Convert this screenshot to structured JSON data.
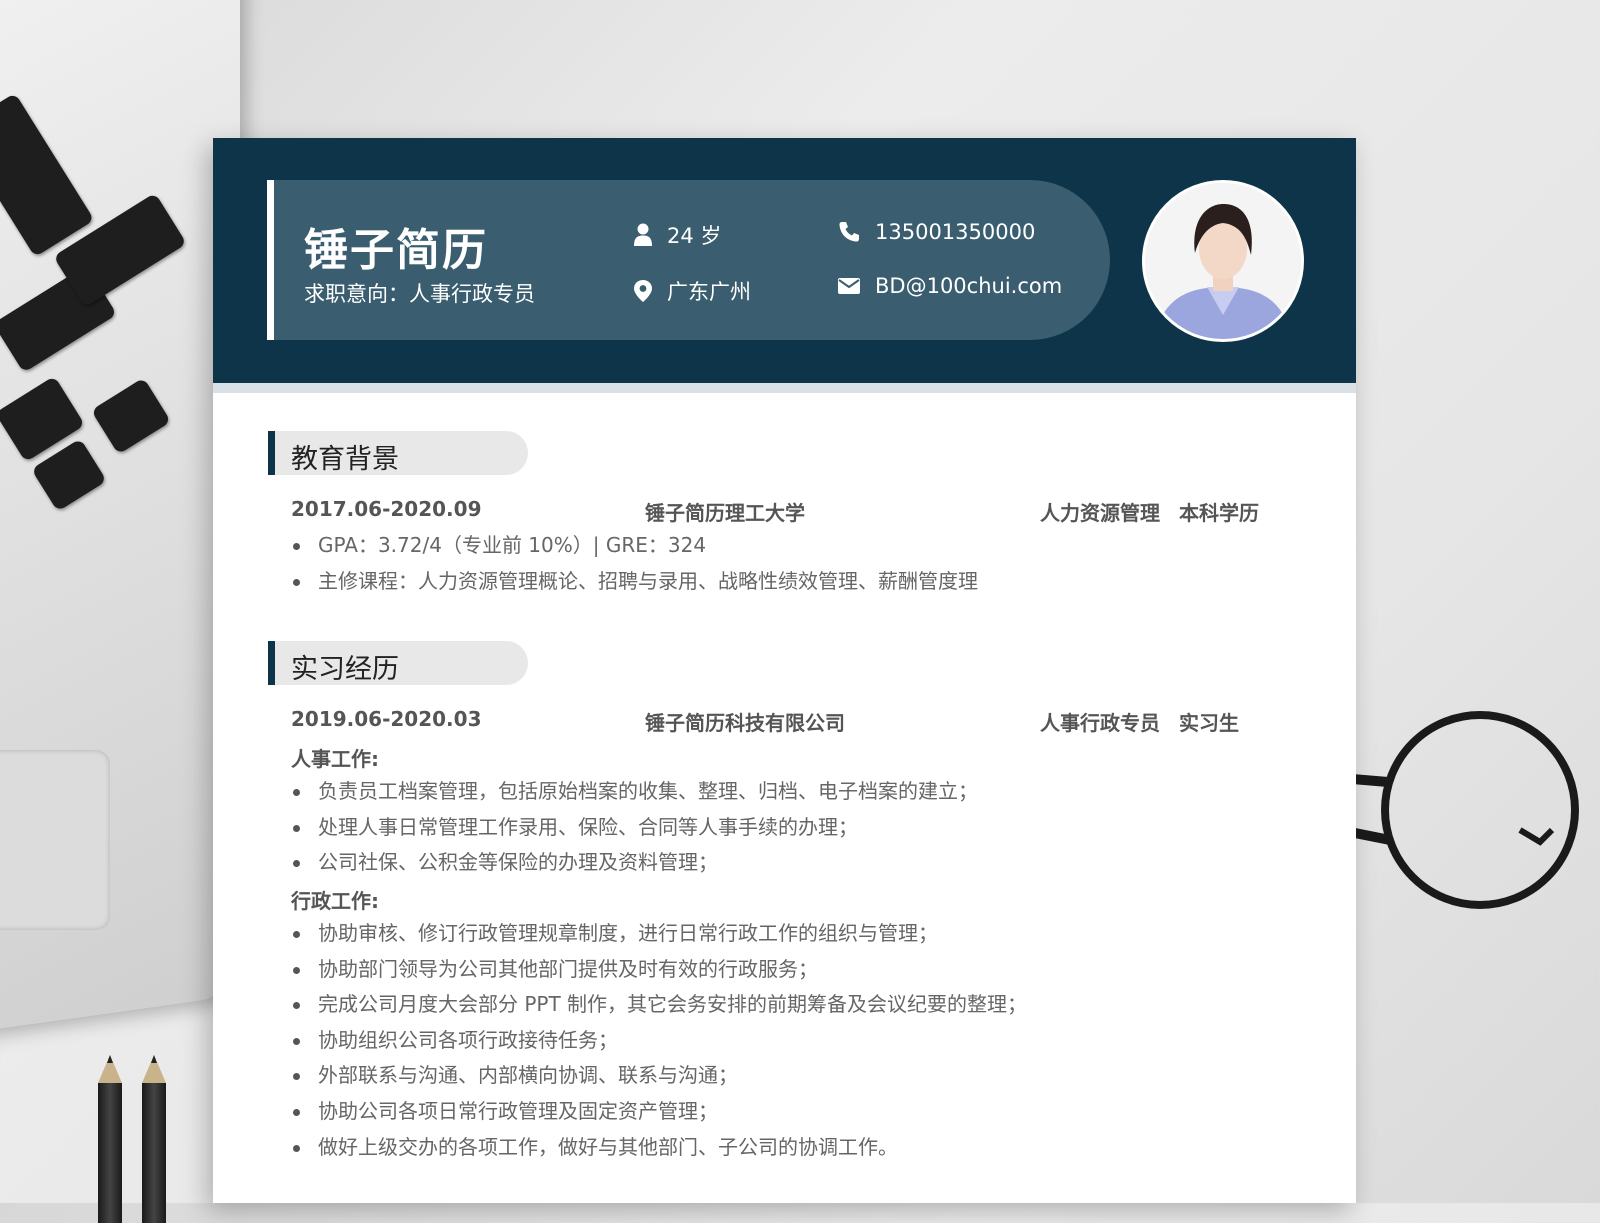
{
  "resume": {
    "name": "锤子简历",
    "intent": "求职意向：人事行政专员",
    "age": "24 岁",
    "location": "广东广州",
    "phone": "135001350000",
    "email": "BD@100chui.com"
  },
  "education": {
    "title": "教育背景",
    "date": "2017.06-2020.09",
    "school": "锤子简历理工大学",
    "major": "人力资源管理",
    "degree": "本科学历",
    "bullets": [
      "GPA：3.72/4（专业前 10%）| GRE：324",
      "主修课程：人力资源管理概论、招聘与录用、战略性绩效管理、薪酬管度理"
    ]
  },
  "internship": {
    "title": "实习经历",
    "date": "2019.06-2020.03",
    "company": "锤子简历科技有限公司",
    "position": "人事行政专员",
    "role": "实习生",
    "hr_title": "人事工作:",
    "hr_items": [
      "负责员工档案管理，包括原始档案的收集、整理、归档、电子档案的建立；",
      "处理人事日常管理工作录用、保险、合同等人事手续的办理；",
      "公司社保、公积金等保险的办理及资料管理；"
    ],
    "admin_title": "行政工作:",
    "admin_items": [
      "协助审核、修订行政管理规章制度，进行日常行政工作的组织与管理；",
      "协助部门领导为公司其他部门提供及时有效的行政服务；",
      "完成公司月度大会部分 PPT 制作，其它会务安排的前期筹备及会议纪要的整理；",
      "协助组织公司各项行政接待任务；",
      "外部联系与沟通、内部横向协调、联系与沟通；",
      "协助公司各项日常行政管理及固定资产管理；",
      "做好上级交办的各项工作，做好与其他部门、子公司的协调工作。"
    ]
  },
  "icons": {
    "age": "person-icon",
    "location": "location-pin-icon",
    "phone": "phone-icon",
    "email": "envelope-icon"
  },
  "colors": {
    "header": "#0d3448",
    "panel": "#3a5e6f",
    "section_tag": "#e8e8e8"
  }
}
